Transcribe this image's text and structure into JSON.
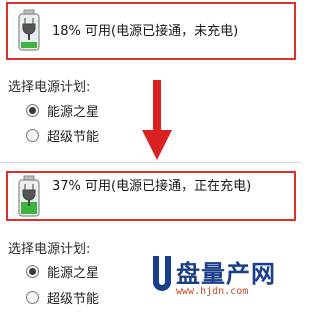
{
  "top": {
    "status_text": "18% 可用(电源已接通，未充电)",
    "plan_label": "选择电源计划:",
    "options": [
      {
        "label": "能源之星",
        "checked": true
      },
      {
        "label": "超级节能",
        "checked": false
      }
    ],
    "battery_level": 0.18
  },
  "bottom": {
    "status_text": "37% 可用(电源已接通，正在充电)",
    "plan_label": "选择电源计划:",
    "options": [
      {
        "label": "能源之星",
        "checked": true
      },
      {
        "label": "超级节能",
        "checked": false
      }
    ],
    "battery_level": 0.37
  },
  "watermark": {
    "logo_text": "盘量产网",
    "url": "www.hjdn.com",
    "logo_text_lettering": "U盘量产网"
  },
  "colors": {
    "highlight_border": "#e0302a",
    "arrow": "#d9221f",
    "battery_green": "#3fb33f"
  },
  "icons": {
    "battery": "battery-plugged-icon",
    "arrow": "arrow-down-icon"
  }
}
